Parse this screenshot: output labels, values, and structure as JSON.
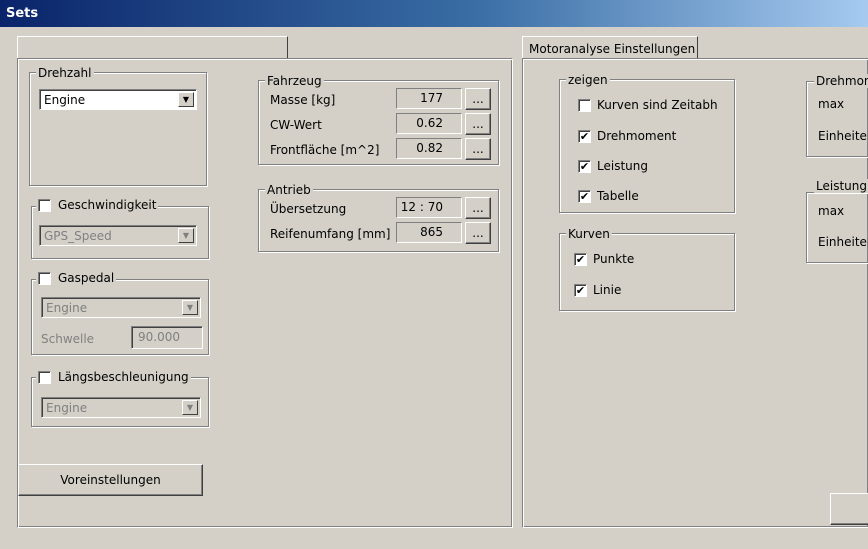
{
  "window": {
    "title": "Sets"
  },
  "left": {
    "drehzahl": {
      "legend": "Drehzahl",
      "value": "Engine"
    },
    "geschwindigkeit": {
      "label": "Geschwindigkeit",
      "value": "GPS_Speed"
    },
    "gaspedal": {
      "label": "Gaspedal",
      "value": "Engine",
      "schwelle_label": "Schwelle",
      "schwelle_value": "90.000"
    },
    "laengs": {
      "label": "Längsbeschleunigung",
      "value": "Engine"
    },
    "voreinstellungen": "Voreinstellungen"
  },
  "fahrzeug": {
    "legend": "Fahrzeug",
    "rows": [
      {
        "label": "Masse [kg]",
        "value": "177"
      },
      {
        "label": "CW-Wert",
        "value": "0.62"
      },
      {
        "label": "Frontfläche [m^2]",
        "value": "0.82"
      }
    ]
  },
  "antrieb": {
    "legend": "Antrieb",
    "rows": [
      {
        "label": "Übersetzung",
        "value": "12 : 70"
      },
      {
        "label": "Reifenumfang [mm]",
        "value": "865"
      }
    ]
  },
  "dots": "...",
  "right": {
    "tab": "Motoranalyse Einstellungen",
    "zeigen": {
      "legend": "zeigen",
      "items": [
        {
          "label": "Kurven sind Zeitabh",
          "checked": false
        },
        {
          "label": "Drehmoment",
          "checked": true
        },
        {
          "label": "Leistung",
          "checked": true
        },
        {
          "label": "Tabelle",
          "checked": true
        }
      ]
    },
    "kurven": {
      "legend": "Kurven",
      "items": [
        {
          "label": "Punkte",
          "checked": true
        },
        {
          "label": "Linie",
          "checked": true
        }
      ]
    },
    "drehmoment": {
      "legend": "Drehmom",
      "max": "max",
      "einheiten": "Einheiten"
    },
    "leistung": {
      "legend": "Leistung",
      "max": "max",
      "einheiten": "Einheiten"
    }
  },
  "checkmark": "✔"
}
